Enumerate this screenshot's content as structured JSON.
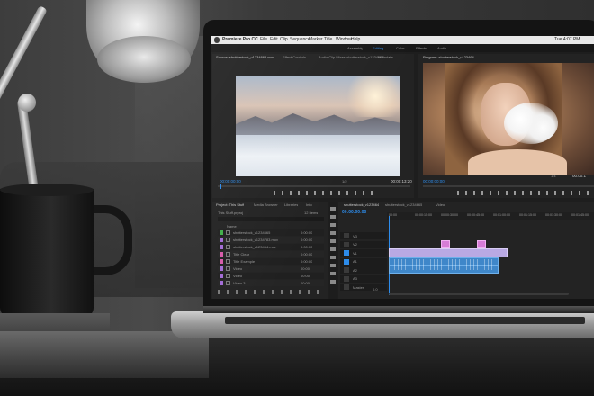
{
  "menubar": {
    "app_name": "Premiere Pro CC",
    "items": [
      "File",
      "Edit",
      "Clip",
      "Sequence",
      "Marker",
      "Title",
      "Window",
      "Help"
    ],
    "clock": "Tue 4:07 PM"
  },
  "workspace_tabs": [
    "Assembly",
    "Editing",
    "Color",
    "Effects",
    "Audio"
  ],
  "source_panel": {
    "tabs": [
      "Source: shutterstock_v1234665.mov",
      "Effect Controls",
      "Audio Clip Mixer: shutterstock_v1234665"
    ],
    "timecode_left": "00:00:00:00",
    "timecode_right": "00:00:13:20",
    "fit": "1/2"
  },
  "program_panel": {
    "tabs": [
      "Metadata",
      "Program: shutterstock_v123464"
    ],
    "timecode_left": "00:00:00:00",
    "timecode_right": "00:00:1",
    "fit": "1/4"
  },
  "project_panel": {
    "tabs": [
      "Project: This Stuff",
      "Media Browser",
      "Libraries",
      "Info"
    ],
    "bin_name": "This Stuff.prproj",
    "item_count": "12 Items",
    "column_header": "Name",
    "items": [
      {
        "name": "shutterstock_v1234665",
        "duration": "0:00:00",
        "color": "#3fae49"
      },
      {
        "name": "shutterstock_v1234783.mov",
        "duration": "0:00:00",
        "color": "#a36cd6"
      },
      {
        "name": "shutterstock_v123464.mov",
        "duration": "0:00:00",
        "color": "#a36cd6"
      },
      {
        "name": "Title Clear",
        "duration": "0:00:00",
        "color": "#d65aa8"
      },
      {
        "name": "Title Example",
        "duration": "0:00:00",
        "color": "#d65aa8"
      },
      {
        "name": "Video",
        "duration": "00:00",
        "color": "#a36cd6"
      },
      {
        "name": "Video",
        "duration": "00:00",
        "color": "#a36cd6"
      },
      {
        "name": "Video 3",
        "duration": "00:00",
        "color": "#a36cd6"
      }
    ]
  },
  "timeline": {
    "tabs": [
      "shutterstock_v123464",
      "shutterstock_v1234665",
      "Video"
    ],
    "timecode": "00:00:00:00",
    "ruler": [
      "00:00",
      "00:00:15:00",
      "00:00:30:00",
      "00:00:45:00",
      "00:01:00:00",
      "00:01:15:00",
      "00:01:30:00",
      "00:01:45:00"
    ],
    "tracks": [
      "V3",
      "V2",
      "V1",
      "A1",
      "A2",
      "A3",
      "Master"
    ],
    "master_level": "0.0"
  },
  "colors": {
    "ui_dark": "#1e1e1e",
    "panel": "#262626",
    "accent_blue": "#2d8ceb",
    "clip_pink": "#d67cd6",
    "clip_video": "#9a8bd8",
    "clip_audio": "#3f87c9"
  }
}
